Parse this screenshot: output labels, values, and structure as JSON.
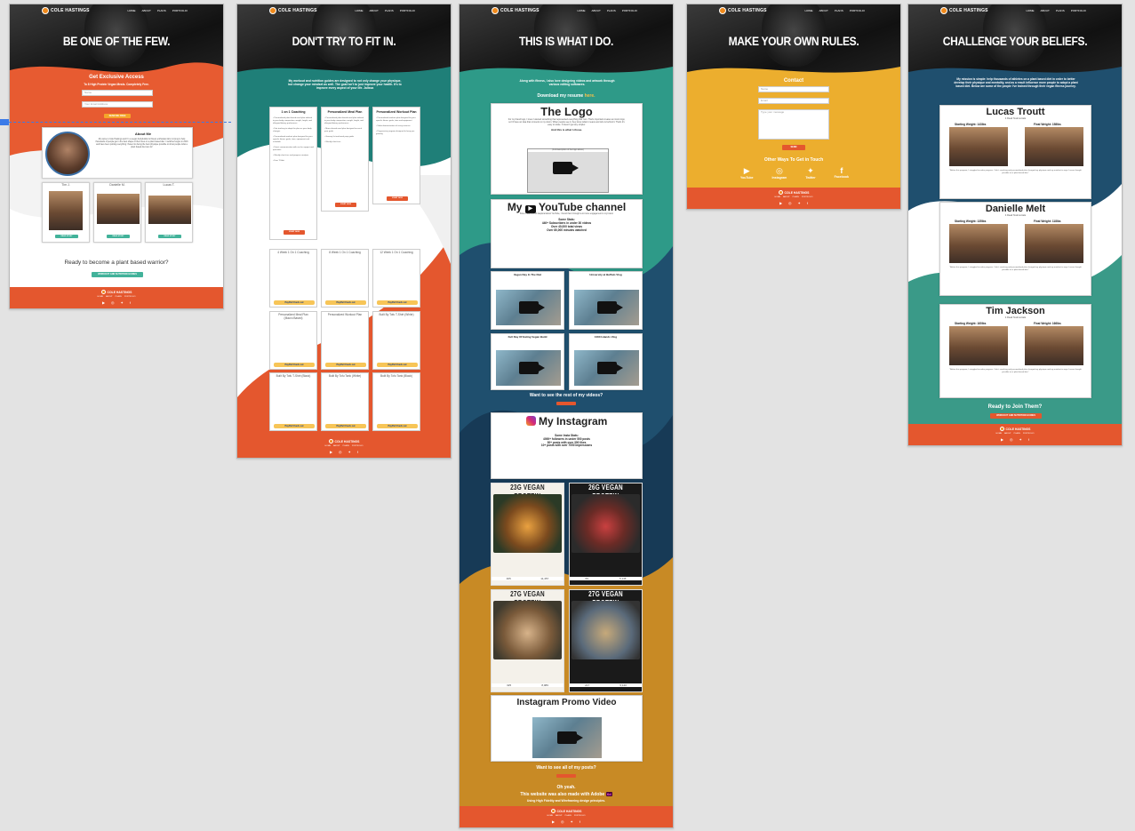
{
  "brand": {
    "name": "COLE HASTINGS",
    "nav": [
      "HOME",
      "ABOUT",
      "PLANS",
      "PORTFOLIO"
    ]
  },
  "footer": {
    "links": [
      "HOME",
      "ABOUT",
      "PLANS",
      "PORTFOLIO"
    ],
    "icons": [
      "youtube-icon",
      "instagram-icon",
      "twitter-icon",
      "facebook-icon"
    ]
  },
  "artboards": [
    {
      "headline": "BE ONE OF THE FEW.",
      "offer_title": "Get Exclusive Access",
      "offer_sub": "To 8 High Protein Vegan Meals.  Completely Free.",
      "name_placeholder": "Name",
      "email_placeholder": "Your Email Address",
      "submit_label": "SEND ME FREE",
      "about_title": "About Me",
      "about_text": "My name is Cole Hastings and I'm a vegan bodybuilder & fitness enthusiast who is trying to help thousands of people get in the best shape of their lives on a plant based diet. I switched vegan in 2016 and have been putting everything I have into being the best physique possible to show people what a plant based diet can do!",
      "clients": [
        {
          "name": "Tim J.",
          "cta": "READ STORY"
        },
        {
          "name": "Danielle M.",
          "cta": "READ STORY"
        },
        {
          "name": "Lucas T.",
          "cta": "READ STORY"
        }
      ],
      "cta_question": "Ready to become a plant based warrior?",
      "cta_button": "WORKOUT AND NUTRITION GUIDES"
    },
    {
      "headline": "DON'T TRY TO FIT IN.",
      "intro": "My workout and nutrition guides are designed to not only change your physique, but change your mindset as well. The goal isn't to just improve your health. It's to improve every aspect of your life. Jalissa",
      "plans": [
        {
          "title": "1 on 1 Coaching",
          "cta": "START NOW"
        },
        {
          "title": "Personalized Meal Plan",
          "cta": "START NOW"
        },
        {
          "title": "Personalized Workout Plan",
          "cta": "START NOW"
        }
      ],
      "products": [
        {
          "name": "4 Week 1 On 1 Coaching"
        },
        {
          "name": "8 Week 1 On 1 Coaching"
        },
        {
          "name": "12 Week 1 On 1 Coaching"
        },
        {
          "name": "Personalized Meal Plan (Macro Based)"
        },
        {
          "name": "Personalized Workout Plan"
        },
        {
          "name": "Built By Tofu T-Shirt (White)"
        },
        {
          "name": "Built By Tofu T-Shirt (Black)"
        },
        {
          "name": "Built By Tofu Tank (White)"
        },
        {
          "name": "Built By Tofu Tank (Black)"
        }
      ],
      "paypal_label": "PayPal Check out"
    },
    {
      "headline": "THIS IS WHAT I DO.",
      "intro": "Along with fitness, I also love designing videos and artwork through various editing softwares.",
      "resume": "Download my resume",
      "resume_link": "here.",
      "logo_title": "The Logo",
      "logo_text": "For my brand logo, I knew I wanted something that represented everything that I am. That's important creates an iconic logo, so I'd have an idea that connects to my vision. When people see it, they know what it means and who is behind it. That's it's easy to relate. It doesn't get any simpler.",
      "logo_sub": "And this is what I chose.",
      "logo_caption": "(Full description of the logo above)",
      "youtube_title_pre": "My",
      "youtube_title_post": "YouTube channel",
      "youtube_text": "Since I was kind of skeptical about YouTube, I found that it brought a lot more engagement to my brand.",
      "youtube_stats": [
        "Some Stats:",
        "440+ Subscribers in under 30 videos",
        "Over 40,000 total views",
        "Over 80,000 minutes watched"
      ],
      "videos": [
        {
          "title": "Vegan Day In The Diet"
        },
        {
          "title": "University at Buffalo Vlog"
        },
        {
          "title": "Full Day Of Eating Vegan Build"
        },
        {
          "title": "1000 Islands Vlog"
        }
      ],
      "videos_cta": "Want to see the rest of my videos?",
      "instagram_title": "My Instagram",
      "instagram_stats": [
        "Some Insta Stats:",
        "4000+ followers in under 500 posts",
        "30+ posts with over 300 likes",
        "10+ posts with over 7000 impressions"
      ],
      "posts": [
        {
          "title": "23G VEGAN PROTEIN",
          "a": "405",
          "b": "11,457"
        },
        {
          "title": "26G VEGAN PROTEIN",
          "a": "69",
          "b": "5,146"
        },
        {
          "title": "27G VEGAN PROTEIN",
          "a": "325",
          "b": "8,089"
        },
        {
          "title": "27G VEGAN PROTEIN",
          "a": "217",
          "b": "5,140"
        }
      ],
      "promo_title": "Instagram Promo Video",
      "promo_cta": "Want to see all of my posts?",
      "outro_1": "Oh yeah.",
      "outro_2": "This website was also made with Adobe",
      "outro_badge": "Xd",
      "outro_3": "Using High Fidelity and Wireframing design principles."
    },
    {
      "headline": "MAKE YOUR OWN RULES.",
      "contact_title": "Contact",
      "name_placeholder": "Name",
      "email_placeholder": "Email",
      "message_placeholder": "Type your message",
      "send_label": "SEND",
      "other_ways": "Other Ways To Get in Touch",
      "channels": [
        "YouTube",
        "Instagram",
        "Twitter",
        "Facebook"
      ]
    },
    {
      "headline": "CHALLENGE YOUR BELIEFS.",
      "intro": "My mission is simple: help thousands of athletes on a plant based diet in order to better develop their physique and mentality, and as a result influence more people to adopt a plant based diet. Below are some of the people I've trained through their vegan fitness journey.",
      "testimonials": [
        {
          "name": "Lucas Troutt",
          "sub": "4 Read Testimonials",
          "start": "Starting Weight: 143lbs",
          "final": "Final Weight: 158lbs"
        },
        {
          "name": "Danielle Melt",
          "sub": "4 Read Testimonials",
          "start": "Starting Weight: 135lbs",
          "final": "Final Weight: 118lbs"
        },
        {
          "name": "Tim Jackson",
          "sub": "4 Read Testimonials",
          "start": "Starting Weight: 160lbs",
          "final": "Final Weight: 166lbs"
        }
      ],
      "cta_question": "Ready to Join Them?",
      "cta_button": "WORKOUT AND NUTRITION GUIDES"
    }
  ]
}
